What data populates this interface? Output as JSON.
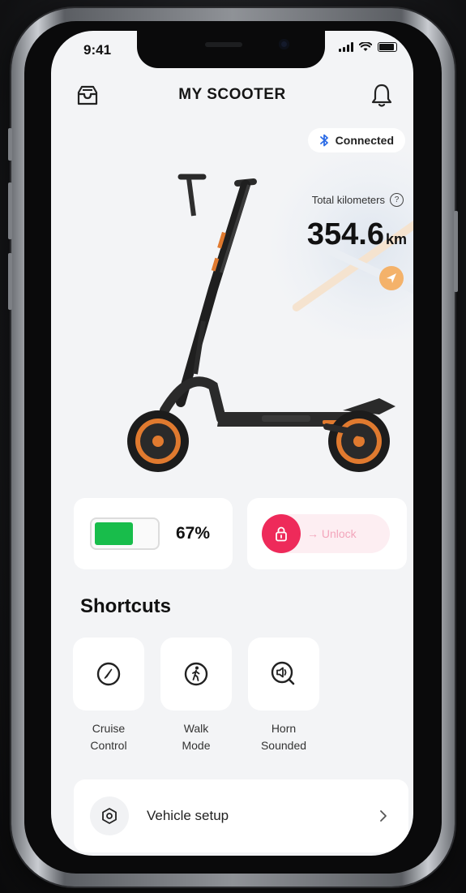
{
  "status_bar": {
    "time": "9:41"
  },
  "header": {
    "title": "MY SCOOTER"
  },
  "connection": {
    "label": "Connected",
    "color": "#2b6be6"
  },
  "odometer": {
    "label": "Total kilometers",
    "value": "354.6",
    "unit": "km"
  },
  "battery": {
    "percent_label": "67%",
    "level": 0.67,
    "color": "#18bd4b"
  },
  "lock": {
    "label": "→ Unlock",
    "accent": "#ee2a5a"
  },
  "shortcuts": {
    "title": "Shortcuts",
    "items": [
      {
        "label": "Cruise\nControl",
        "icon": "speedometer-icon"
      },
      {
        "label": "Walk\nMode",
        "icon": "walking-person-icon"
      },
      {
        "label": "Horn\nSounded",
        "icon": "horn-speaker-icon"
      }
    ]
  },
  "vehicle_setup": {
    "label": "Vehicle setup",
    "icon": "hexagon-nut-icon"
  }
}
